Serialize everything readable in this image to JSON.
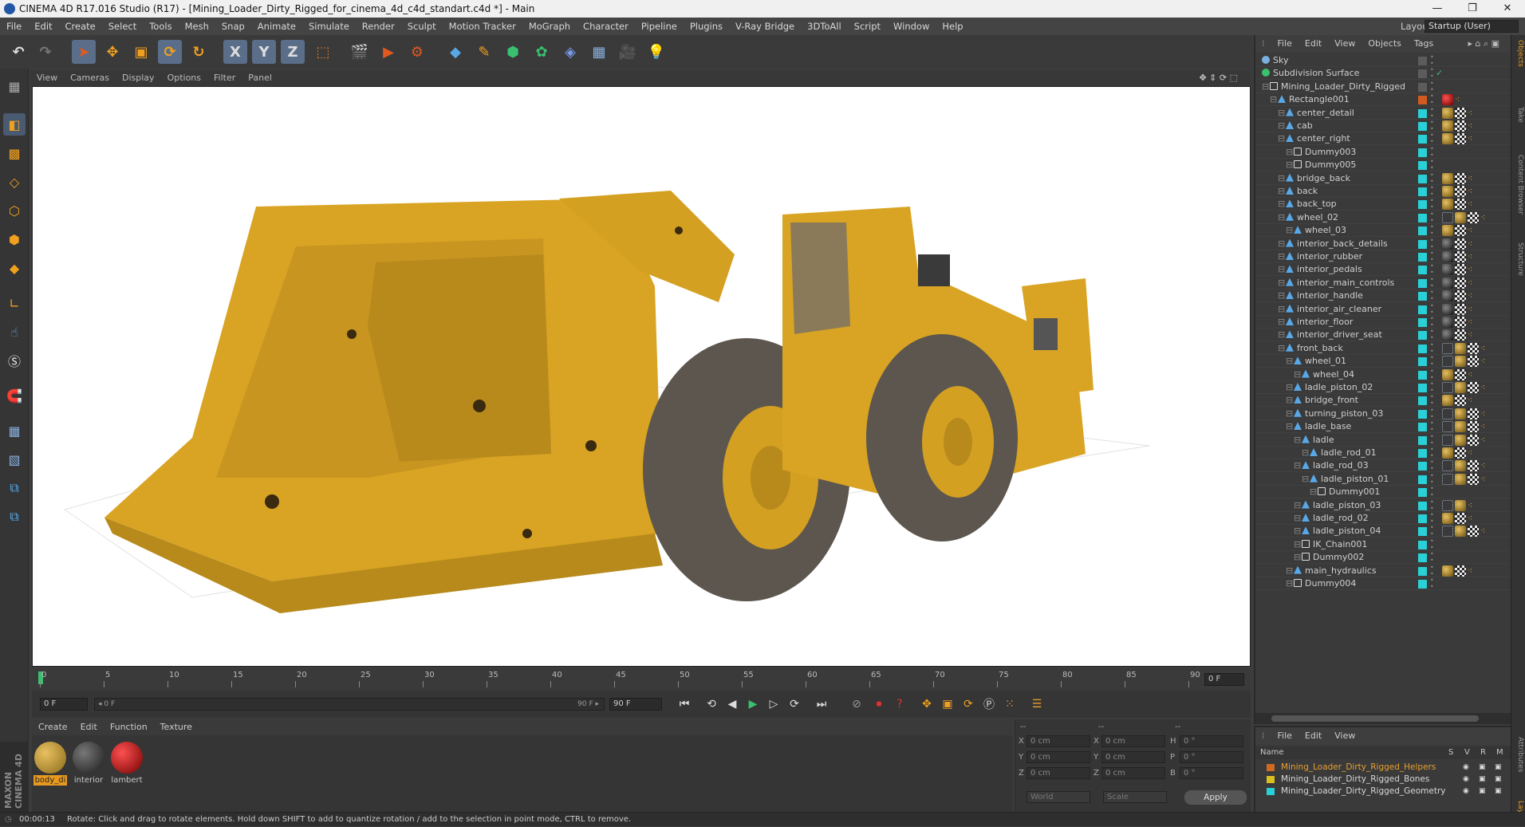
{
  "window": {
    "title": "CINEMA 4D R17.016 Studio (R17) - [Mining_Loader_Dirty_Rigged_for_cinema_4d_c4d_standart.c4d *] - Main",
    "controls": [
      "—",
      "❐",
      "✕"
    ]
  },
  "menubar": {
    "items": [
      "File",
      "Edit",
      "Create",
      "Select",
      "Tools",
      "Mesh",
      "Snap",
      "Animate",
      "Simulate",
      "Render",
      "Sculpt",
      "Motion Tracker",
      "MoGraph",
      "Character",
      "Pipeline",
      "Plugins",
      "V-Ray Bridge",
      "3DToAll",
      "Script",
      "Window",
      "Help"
    ],
    "layout_label": "Layout:",
    "layout_value": "Startup (User)"
  },
  "toolbar": {
    "axis_x": "X",
    "axis_y": "Y",
    "axis_z": "Z"
  },
  "viewport": {
    "menu": [
      "View",
      "Cameras",
      "Display",
      "Options",
      "Filter",
      "Panel"
    ]
  },
  "timeline": {
    "ticks": [
      "0",
      "5",
      "10",
      "15",
      "20",
      "25",
      "30",
      "35",
      "40",
      "45",
      "50",
      "55",
      "60",
      "65",
      "70",
      "75",
      "80",
      "85",
      "90"
    ],
    "current_frame_field": "0 F",
    "start_field": "0 F",
    "range_start": "◂ 0 F",
    "range_end": "90 F ▸",
    "end_field": "90 F"
  },
  "material_manager": {
    "menu": [
      "Create",
      "Edit",
      "Function",
      "Texture"
    ],
    "materials": [
      {
        "name": "body_di",
        "color": "#c89a28",
        "selected": true
      },
      {
        "name": "interior",
        "color": "#3a3a3a",
        "selected": false
      },
      {
        "name": "lambert",
        "color": "#c01010",
        "selected": false
      }
    ]
  },
  "coordinates": {
    "header1": "--",
    "header2": "--",
    "header3": "--",
    "rows": [
      {
        "l1": "X",
        "v1": "0 cm",
        "l2": "X",
        "v2": "0 cm",
        "l3": "H",
        "v3": "0 °"
      },
      {
        "l1": "Y",
        "v1": "0 cm",
        "l2": "Y",
        "v2": "0 cm",
        "l3": "P",
        "v3": "0 °"
      },
      {
        "l1": "Z",
        "v1": "0 cm",
        "l2": "Z",
        "v2": "0 cm",
        "l3": "B",
        "v3": "0 °"
      }
    ],
    "mode1": "World",
    "mode2": "Scale",
    "apply": "Apply"
  },
  "object_manager": {
    "menu": [
      "File",
      "Edit",
      "View",
      "Objects",
      "Tags"
    ],
    "objects": [
      {
        "name": "Sky",
        "depth": 0,
        "icon": "sky",
        "color": "#5c5c5c",
        "tags": []
      },
      {
        "name": "Subdivision Surface",
        "depth": 0,
        "icon": "subd",
        "color": "#5c5c5c",
        "tags": [],
        "check": "✓"
      },
      {
        "name": "Mining_Loader_Dirty_Rigged",
        "depth": 1,
        "icon": "null",
        "color": "#5c5c5c",
        "tags": []
      },
      {
        "name": "Rectangle001",
        "depth": 2,
        "icon": "poly",
        "color": "#d05a20",
        "tags": [
          "red",
          "dot"
        ]
      },
      {
        "name": "center_detail",
        "depth": 3,
        "icon": "poly",
        "color": "#2ad0d8",
        "tags": [
          "mat",
          "chk",
          "dot"
        ]
      },
      {
        "name": "cab",
        "depth": 3,
        "icon": "poly",
        "color": "#2ad0d8",
        "tags": [
          "mat",
          "chk",
          "dot"
        ]
      },
      {
        "name": "center_right",
        "depth": 3,
        "icon": "poly",
        "color": "#2ad0d8",
        "tags": [
          "mat",
          "chk",
          "dot"
        ]
      },
      {
        "name": "Dummy003",
        "depth": 4,
        "icon": "null",
        "color": "#2ad0d8",
        "tags": []
      },
      {
        "name": "Dummy005",
        "depth": 4,
        "icon": "null",
        "color": "#2ad0d8",
        "tags": []
      },
      {
        "name": "bridge_back",
        "depth": 3,
        "icon": "poly",
        "color": "#2ad0d8",
        "tags": [
          "mat",
          "chk",
          "dot"
        ]
      },
      {
        "name": "back",
        "depth": 3,
        "icon": "poly",
        "color": "#2ad0d8",
        "tags": [
          "mat",
          "chk",
          "dot"
        ]
      },
      {
        "name": "back_top",
        "depth": 3,
        "icon": "poly",
        "color": "#2ad0d8",
        "tags": [
          "mat",
          "chk",
          "dot"
        ]
      },
      {
        "name": "wheel_02",
        "depth": 3,
        "icon": "poly",
        "color": "#2ad0d8",
        "tags": [
          "ik",
          "mat",
          "chk",
          "dot"
        ]
      },
      {
        "name": "wheel_03",
        "depth": 4,
        "icon": "poly",
        "color": "#2ad0d8",
        "tags": [
          "mat",
          "chk",
          "dot"
        ]
      },
      {
        "name": "interior_back_details",
        "depth": 3,
        "icon": "poly",
        "color": "#2ad0d8",
        "tags": [
          "dark",
          "chk",
          "dot"
        ]
      },
      {
        "name": "interior_rubber",
        "depth": 3,
        "icon": "poly",
        "color": "#2ad0d8",
        "tags": [
          "dark",
          "chk",
          "dot"
        ]
      },
      {
        "name": "interior_pedals",
        "depth": 3,
        "icon": "poly",
        "color": "#2ad0d8",
        "tags": [
          "dark",
          "chk",
          "dot"
        ]
      },
      {
        "name": "interior_main_controls",
        "depth": 3,
        "icon": "poly",
        "color": "#2ad0d8",
        "tags": [
          "dark",
          "chk",
          "dot"
        ]
      },
      {
        "name": "interior_handle",
        "depth": 3,
        "icon": "poly",
        "color": "#2ad0d8",
        "tags": [
          "dark",
          "chk",
          "dot"
        ]
      },
      {
        "name": "interior_air_cleaner",
        "depth": 3,
        "icon": "poly",
        "color": "#2ad0d8",
        "tags": [
          "dark",
          "chk",
          "dot"
        ]
      },
      {
        "name": "interior_floor",
        "depth": 3,
        "icon": "poly",
        "color": "#2ad0d8",
        "tags": [
          "dark",
          "chk",
          "dot"
        ]
      },
      {
        "name": "interior_driver_seat",
        "depth": 3,
        "icon": "poly",
        "color": "#2ad0d8",
        "tags": [
          "dark",
          "chk",
          "dot"
        ]
      },
      {
        "name": "front_back",
        "depth": 3,
        "icon": "poly",
        "color": "#2ad0d8",
        "tags": [
          "ik",
          "mat",
          "chk",
          "dot"
        ]
      },
      {
        "name": "wheel_01",
        "depth": 4,
        "icon": "poly",
        "color": "#2ad0d8",
        "tags": [
          "ik",
          "mat",
          "chk",
          "dot"
        ]
      },
      {
        "name": "wheel_04",
        "depth": 5,
        "icon": "poly",
        "color": "#2ad0d8",
        "tags": [
          "mat",
          "chk",
          "dot"
        ]
      },
      {
        "name": "ladle_piston_02",
        "depth": 4,
        "icon": "poly",
        "color": "#2ad0d8",
        "tags": [
          "ik",
          "mat",
          "chk",
          "dot"
        ]
      },
      {
        "name": "bridge_front",
        "depth": 4,
        "icon": "poly",
        "color": "#2ad0d8",
        "tags": [
          "mat",
          "chk",
          "dot"
        ]
      },
      {
        "name": "turning_piston_03",
        "depth": 4,
        "icon": "poly",
        "color": "#2ad0d8",
        "tags": [
          "ik",
          "mat",
          "chk",
          "dot"
        ]
      },
      {
        "name": "ladle_base",
        "depth": 4,
        "icon": "poly",
        "color": "#2ad0d8",
        "tags": [
          "ik",
          "mat",
          "chk",
          "dot"
        ]
      },
      {
        "name": "ladle",
        "depth": 5,
        "icon": "poly",
        "color": "#2ad0d8",
        "tags": [
          "ik",
          "mat",
          "chk",
          "dot"
        ]
      },
      {
        "name": "ladle_rod_01",
        "depth": 6,
        "icon": "poly",
        "color": "#2ad0d8",
        "tags": [
          "mat",
          "chk",
          "dot"
        ]
      },
      {
        "name": "ladle_rod_03",
        "depth": 5,
        "icon": "poly",
        "color": "#2ad0d8",
        "tags": [
          "ik",
          "mat",
          "chk",
          "dot"
        ]
      },
      {
        "name": "ladle_piston_01",
        "depth": 6,
        "icon": "poly",
        "color": "#2ad0d8",
        "tags": [
          "ik",
          "mat",
          "chk",
          "dot"
        ]
      },
      {
        "name": "Dummy001",
        "depth": 7,
        "icon": "null",
        "color": "#2ad0d8",
        "tags": []
      },
      {
        "name": "ladle_piston_03",
        "depth": 5,
        "icon": "poly",
        "color": "#2ad0d8",
        "tags": [
          "ik",
          "mat",
          "dot"
        ]
      },
      {
        "name": "ladle_rod_02",
        "depth": 5,
        "icon": "poly",
        "color": "#2ad0d8",
        "tags": [
          "mat",
          "chk",
          "dot"
        ]
      },
      {
        "name": "ladle_piston_04",
        "depth": 5,
        "icon": "poly",
        "color": "#2ad0d8",
        "tags": [
          "ik",
          "mat",
          "chk",
          "dot"
        ]
      },
      {
        "name": "IK_Chain001",
        "depth": 5,
        "icon": "null",
        "color": "#2ad0d8",
        "tags": []
      },
      {
        "name": "Dummy002",
        "depth": 5,
        "icon": "null",
        "color": "#2ad0d8",
        "tags": []
      },
      {
        "name": "main_hydraulics",
        "depth": 4,
        "icon": "poly",
        "color": "#2ad0d8",
        "tags": [
          "mat",
          "chk",
          "dot"
        ]
      },
      {
        "name": "Dummy004",
        "depth": 4,
        "icon": "null",
        "color": "#2ad0d8",
        "tags": []
      }
    ]
  },
  "layer_manager": {
    "menu": [
      "File",
      "Edit",
      "View"
    ],
    "col_name": "Name",
    "cols": [
      "S",
      "V",
      "R",
      "M"
    ],
    "layers": [
      {
        "name": "Mining_Loader_Dirty_Rigged_Helpers",
        "color": "#d06a20",
        "text_color": "#e8a030"
      },
      {
        "name": "Mining_Loader_Dirty_Rigged_Bones",
        "color": "#d8c020",
        "text_color": "#d8d8d8"
      },
      {
        "name": "Mining_Loader_Dirty_Rigged_Geometry",
        "color": "#2ad0d8",
        "text_color": "#d8d8d8"
      }
    ]
  },
  "right_tabs": [
    "Objects",
    "Take",
    "Content Browser",
    "Structure",
    "Attributes",
    "Layers"
  ],
  "status": {
    "time": "00:00:13",
    "message": "Rotate: Click and drag to rotate elements. Hold down SHIFT to add to quantize rotation / add to the selection in point mode, CTRL to remove."
  },
  "brand": "MAXON CINEMA 4D"
}
